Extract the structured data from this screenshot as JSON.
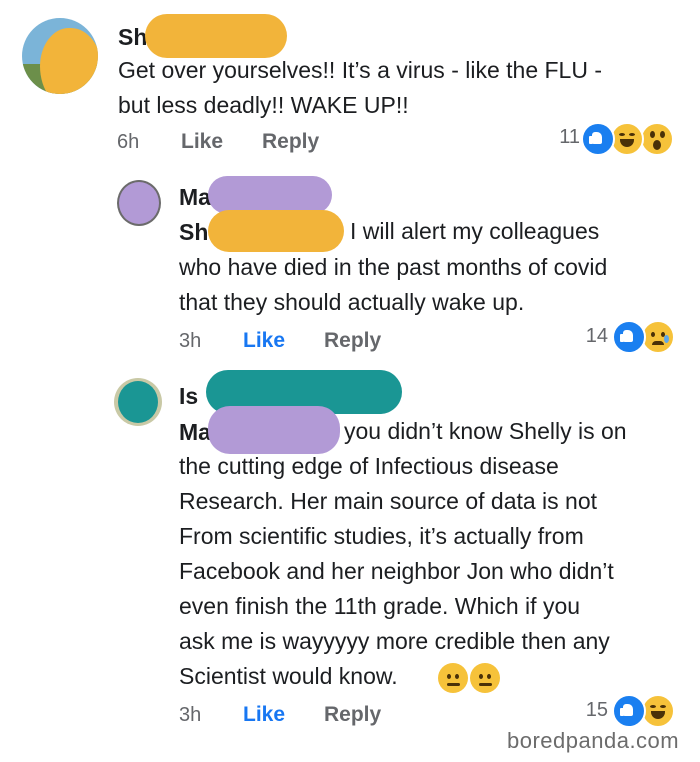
{
  "comments": [
    {
      "name": "Sh",
      "lines": [
        "Get over yourselves!!  It’s a virus - like the FLU -",
        "but less deadly!!    WAKE UP!!"
      ],
      "time": "6h",
      "like_label": "Like",
      "reply_label": "Reply",
      "reaction_count": "11",
      "reactions": [
        "like",
        "haha",
        "wow"
      ]
    },
    {
      "name": "Ma",
      "tag": "Sh",
      "lines": [
        "I will alert my colleagues",
        "who have died in the past months of covid",
        "that they should actually wake up."
      ],
      "time": "3h",
      "like_label": "Like",
      "reply_label": "Reply",
      "reaction_count": "14",
      "reactions": [
        "like",
        "sad"
      ]
    },
    {
      "name": "Is",
      "tag": "Ma",
      "lines": [
        "you didn’t know Shelly is on",
        "the cutting edge of Infectious disease",
        "Research.  Her main source of data is not",
        "From scientific studies, it’s actually from",
        "Facebook and her neighbor Jon who didn’t",
        "even finish the 11th grade.  Which if you",
        "ask me is wayyyyy more credible then any",
        "Scientist would know."
      ],
      "inline_emoji": [
        "neutral-face",
        "neutral-face"
      ],
      "time": "3h",
      "like_label": "Like",
      "reply_label": "Reply",
      "reaction_count": "15",
      "reactions": [
        "like",
        "haha"
      ]
    }
  ],
  "watermark": "boredpanda.com"
}
